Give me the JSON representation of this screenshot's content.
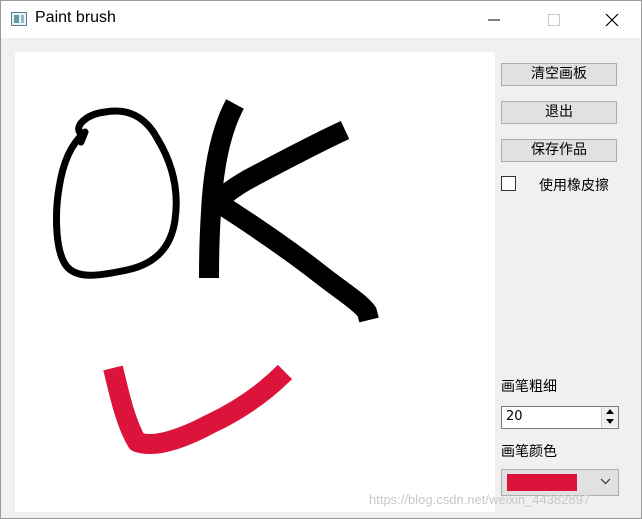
{
  "window": {
    "title": "Paint brush",
    "icon": "app-window-icon"
  },
  "title_controls": {
    "minimize_icon": "minimize-icon",
    "maximize_icon": "maximize-icon",
    "close_icon": "close-icon"
  },
  "canvas": {
    "background": "#ffffff",
    "strokes": [
      {
        "name": "letter-o",
        "color": "#000000"
      },
      {
        "name": "letter-k",
        "color": "#000000"
      },
      {
        "name": "check-mark",
        "color": "#dc143c"
      }
    ]
  },
  "buttons": {
    "clear": "清空画板",
    "exit": "退出",
    "save": "保存作品"
  },
  "eraser": {
    "label": "使用橡皮擦",
    "checked": false
  },
  "pen_width": {
    "label": "画笔粗细",
    "value": "20"
  },
  "pen_color": {
    "label": "画笔颜色",
    "color": "#dc143c",
    "dropdown_icon": "chevron-down-icon"
  },
  "watermark": "https://blog.csdn.net/weixin_44382897"
}
